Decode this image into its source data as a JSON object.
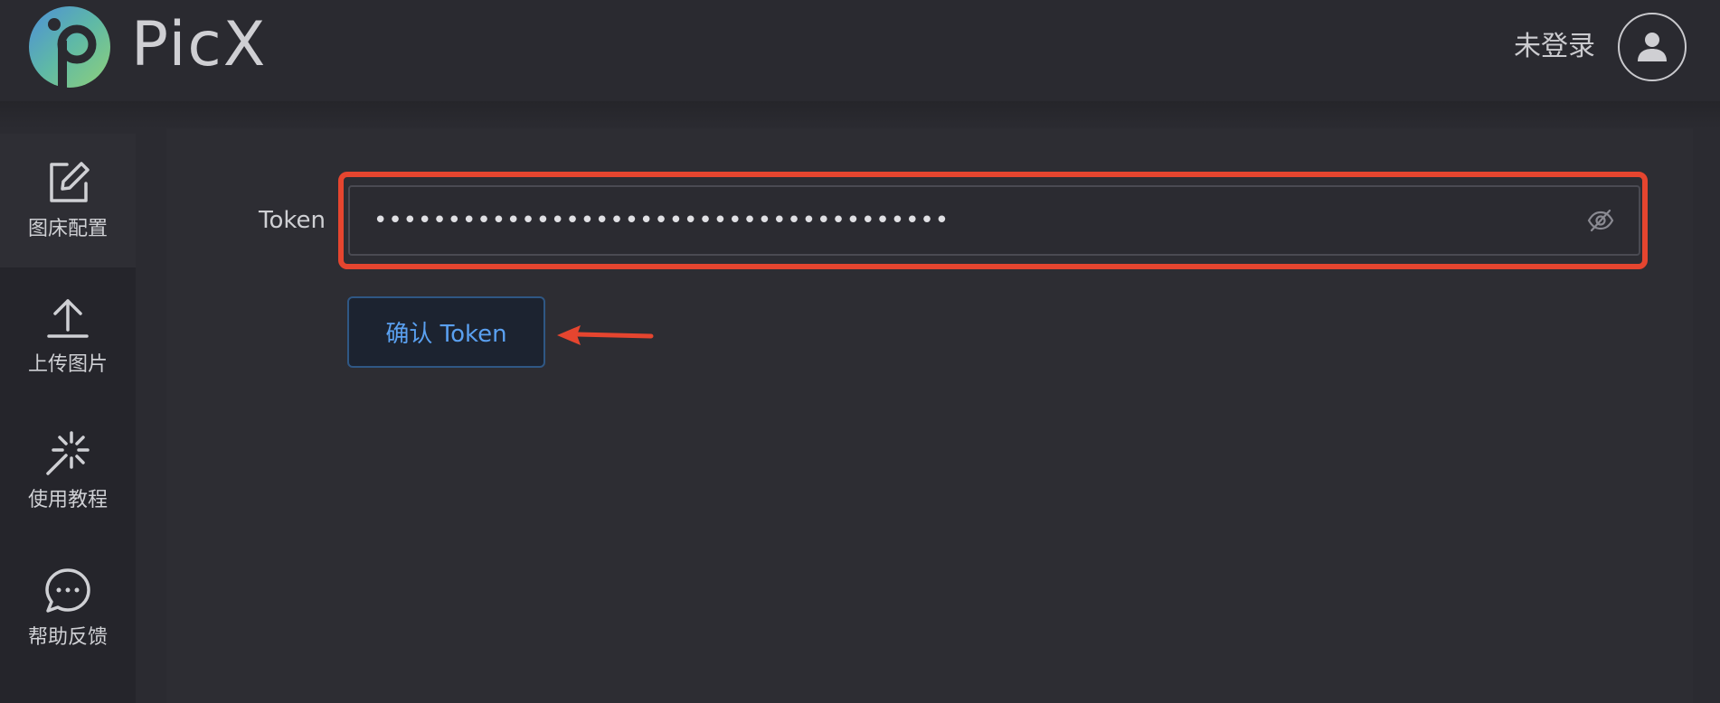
{
  "header": {
    "app_name": "PicX",
    "login_status": "未登录",
    "logo_icon": "picx-logo-icon",
    "avatar_icon": "user-avatar-icon"
  },
  "sidebar": {
    "items": [
      {
        "label": "图床配置",
        "icon": "edit-icon",
        "active": true
      },
      {
        "label": "上传图片",
        "icon": "upload-icon",
        "active": false
      },
      {
        "label": "使用教程",
        "icon": "magic-wand-icon",
        "active": false
      },
      {
        "label": "帮助反馈",
        "icon": "chat-bubble-icon",
        "active": false
      }
    ]
  },
  "form": {
    "token_label": "Token",
    "token_value": "•••••••••••••••••••••••••••••••••••••••",
    "toggle_visibility_icon": "eye-off-icon",
    "confirm_button_label": "确认 Token"
  },
  "annotations": {
    "highlight_color": "#e5452f",
    "arrow_color": "#e5452f"
  },
  "colors": {
    "background": "#2b2b31",
    "accent": "#5aa0f0"
  }
}
